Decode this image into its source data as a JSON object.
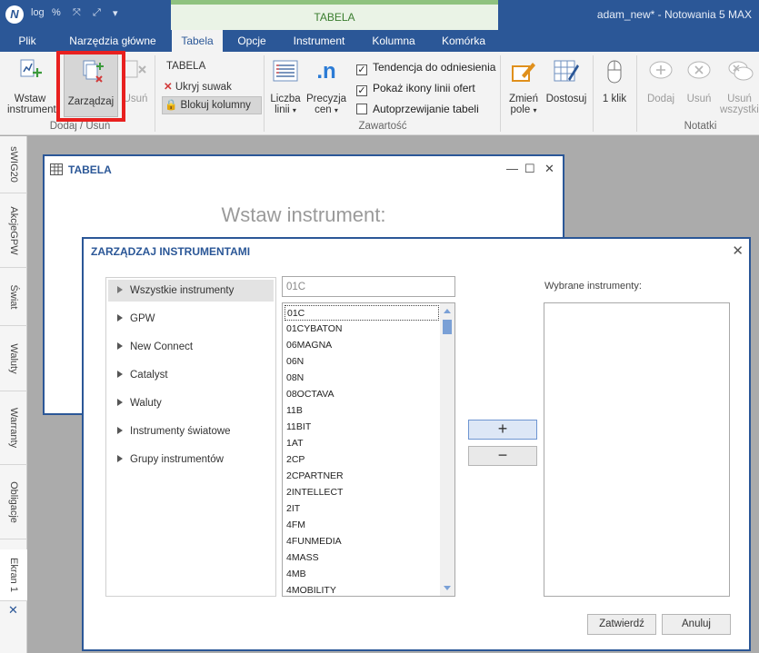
{
  "titlebar": {
    "logo": "N",
    "quick_access": [
      "log",
      "%",
      "⤧",
      "⤢",
      "▾"
    ],
    "context_tab": "TABELA",
    "window_title": "adam_new* - Notowania 5 MAX"
  },
  "tabs": [
    {
      "label": "Plik"
    },
    {
      "label": "Narzędzia główne"
    },
    {
      "label": "Tabela",
      "active": true
    },
    {
      "label": "Opcje"
    },
    {
      "label": "Instrument"
    },
    {
      "label": "Kolumna"
    },
    {
      "label": "Komórka"
    }
  ],
  "ribbon": {
    "insert_line1": "Wstaw",
    "insert_line2": "instrument",
    "manage": "Zarządzaj",
    "remove": "Usuń",
    "group_addremove": "Dodaj / Usuń",
    "tabela_label": "TABELA",
    "hide_slider": "Ukryj suwak",
    "lock_columns": "Blokuj kolumny",
    "lines_line1": "Liczba",
    "lines_line2": "linii",
    "precision_line1": "Precyzja",
    "precision_line2": "cen",
    "chk_trend": "Tendencja do odniesienia",
    "chk_icons": "Pokaż ikony linii ofert",
    "chk_autoscroll": "Autoprzewijanie tabeli",
    "group_content": "Zawartość",
    "change_field_line1": "Zmień",
    "change_field_line2": "pole",
    "customize": "Dostosuj",
    "one_click": "1 klik",
    "notes_add": "Dodaj",
    "notes_remove": "Usuń",
    "notes_remove_all_line1": "Usuń",
    "notes_remove_all_line2": "wszystkie",
    "group_notes": "Notatki",
    "checkbox_states": {
      "trend": true,
      "icons": true,
      "autoscroll": false
    }
  },
  "left_tabs": [
    "sWIG20",
    "AkcjeGPW",
    "Świat",
    "Waluty",
    "Warranty",
    "Obligacje",
    "Ekran 1"
  ],
  "tabela_window": {
    "title": "TABELA",
    "hint": "Wstaw instrument:"
  },
  "dialog": {
    "title": "ZARZĄDZAJ INSTRUMENTAMI",
    "categories": [
      "Wszystkie instrumenty",
      "GPW",
      "New Connect",
      "Catalyst",
      "Waluty",
      "Instrumenty światowe",
      "Grupy instrumentów"
    ],
    "search_value": "01C",
    "instruments": [
      "01C",
      "01CYBATON",
      "06MAGNA",
      "06N",
      "08N",
      "08OCTAVA",
      "11B",
      "11BIT",
      "1AT",
      "2CP",
      "2CPARTNER",
      "2INTELLECT",
      "2IT",
      "4FM",
      "4FUNMEDIA",
      "4MASS",
      "4MB",
      "4MOBILITY"
    ],
    "add_symbol": "+",
    "remove_symbol": "−",
    "selected_label": "Wybrane instrumenty:",
    "confirm": "Zatwierdź",
    "cancel": "Anuluj"
  }
}
